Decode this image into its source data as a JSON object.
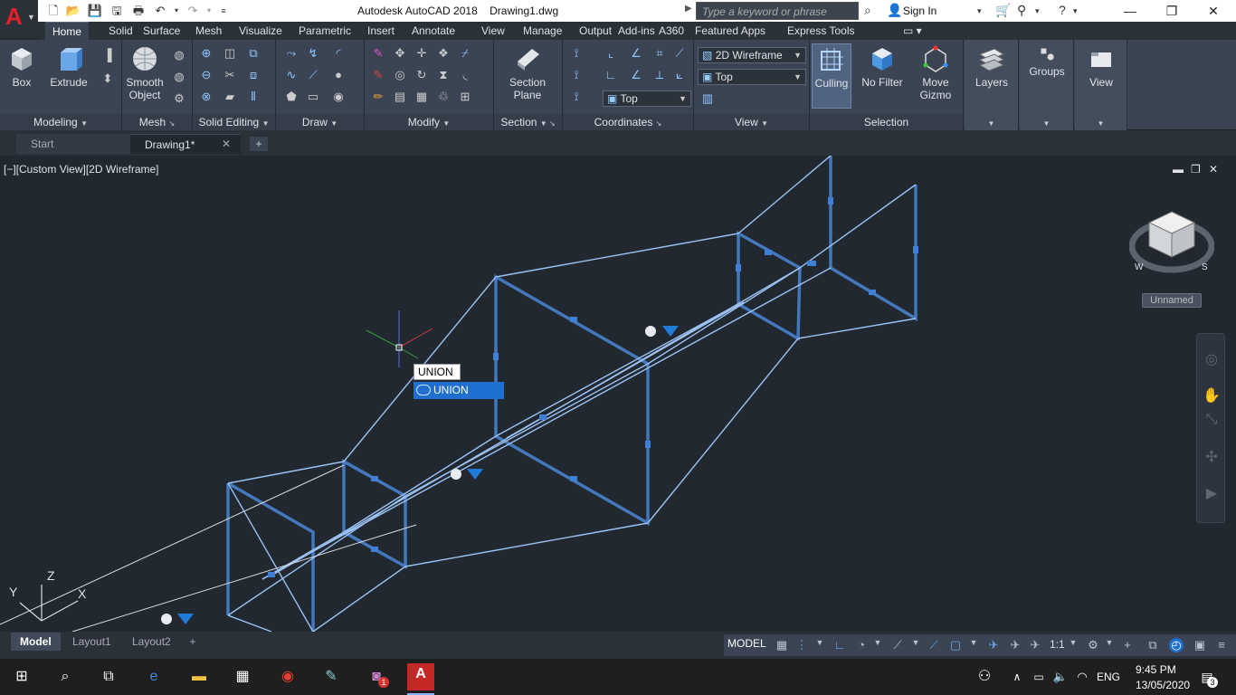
{
  "titlebar": {
    "app_title": "Autodesk AutoCAD 2018",
    "file_name": "Drawing1.dwg",
    "search_placeholder": "Type a keyword or phrase",
    "signin_label": "Sign In"
  },
  "ribbon_tabs": [
    "Home",
    "Solid",
    "Surface",
    "Mesh",
    "Visualize",
    "Parametric",
    "Insert",
    "Annotate",
    "View",
    "Manage",
    "Output",
    "Add-ins",
    "A360",
    "Featured Apps",
    "Express Tools"
  ],
  "panels": {
    "modeling": {
      "title": "Modeling",
      "box": "Box",
      "extrude": "Extrude"
    },
    "mesh": {
      "title": "Mesh",
      "smooth_object": "Smooth Object"
    },
    "solid_editing": {
      "title": "Solid Editing"
    },
    "draw": {
      "title": "Draw"
    },
    "modify": {
      "title": "Modify"
    },
    "section": {
      "title": "Section",
      "section_plane": "Section Plane"
    },
    "coordinates": {
      "title": "Coordinates",
      "ucs_value": "Top"
    },
    "view": {
      "title": "View",
      "visual_style": "2D Wireframe",
      "view_value": "Top"
    },
    "selection": {
      "title": "Selection",
      "culling": "Culling",
      "no_filter": "No Filter",
      "move_gizmo": "Move Gizmo"
    },
    "layers": {
      "label": "Layers"
    },
    "groups": {
      "label": "Groups"
    },
    "view_panel": {
      "label": "View"
    }
  },
  "doc_tabs": {
    "start": "Start",
    "drawing": "Drawing1*"
  },
  "viewport": {
    "label": "[−][Custom View][2D Wireframe]",
    "command_text": "UNION",
    "suggestion": "UNION",
    "viewcube_named": "Unnamed",
    "axis_x": "X",
    "axis_y": "Y",
    "axis_z": "Z"
  },
  "layout_tabs": [
    "Model",
    "Layout1",
    "Layout2"
  ],
  "status": {
    "model": "MODEL",
    "scale": "1:1"
  },
  "taskbar": {
    "lang": "ENG",
    "time": "9:45 PM",
    "date": "13/05/2020",
    "notif_count": "3",
    "badge": "1"
  },
  "colors": {
    "accent": "#1e6fd0",
    "canvas": "#212830",
    "wire": "#4a86d6",
    "ribbon": "#3b4453"
  }
}
